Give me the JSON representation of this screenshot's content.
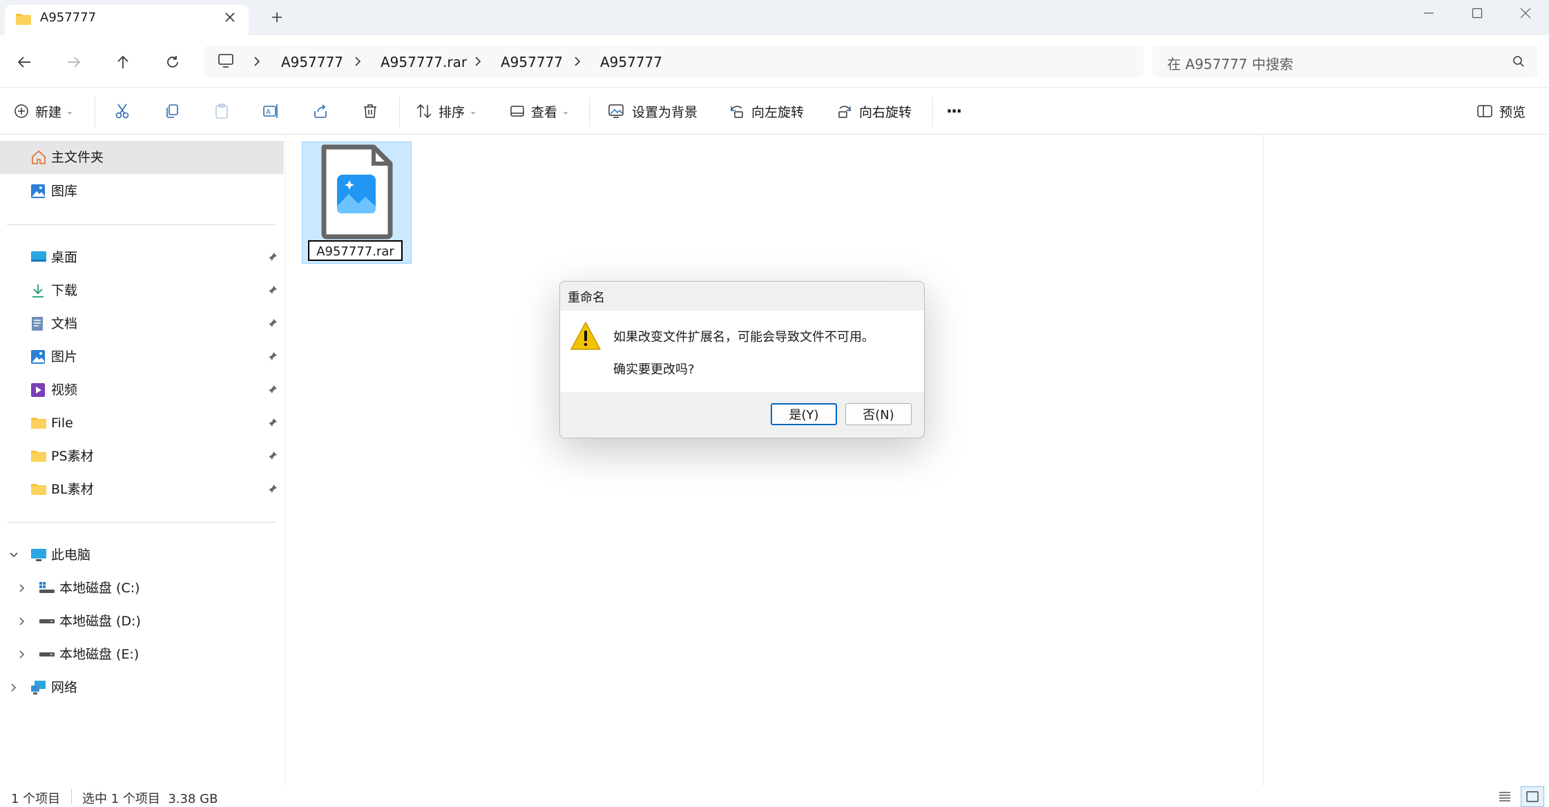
{
  "window": {
    "tab_title": "A957777",
    "new_tab": "+"
  },
  "nav": {
    "breadcrumbs": [
      "A957777",
      "A957777.rar",
      "A957777",
      "A957777"
    ],
    "search_placeholder": "在 A957777 中搜索"
  },
  "toolbar": {
    "new_label": "新建",
    "sort_label": "排序",
    "view_label": "查看",
    "set_bg_label": "设置为背景",
    "rotate_left_label": "向左旋转",
    "rotate_right_label": "向右旋转",
    "more_label": "···",
    "preview_label": "预览"
  },
  "sidebar": {
    "home": "主文件夹",
    "gallery": "图库",
    "quick": [
      "桌面",
      "下载",
      "文档",
      "图片",
      "视频",
      "File",
      "PS素材",
      "BL素材"
    ],
    "this_pc": "此电脑",
    "drives": [
      "本地磁盘 (C:)",
      "本地磁盘 (D:)",
      "本地磁盘 (E:)"
    ],
    "network": "网络"
  },
  "content": {
    "file_name": "A957777.rar"
  },
  "dialog": {
    "title": "重命名",
    "line1": "如果改变文件扩展名，可能会导致文件不可用。",
    "line2": "确实要更改吗?",
    "yes": "是(Y)",
    "no": "否(N)"
  },
  "status": {
    "count": "1 个项目",
    "selected": "选中 1 个项目  3.38 GB"
  },
  "colors": {
    "accent": "#0067c0",
    "folder": "#f8c23a",
    "warning": "#f4c300",
    "selection": "#cce8ff"
  }
}
